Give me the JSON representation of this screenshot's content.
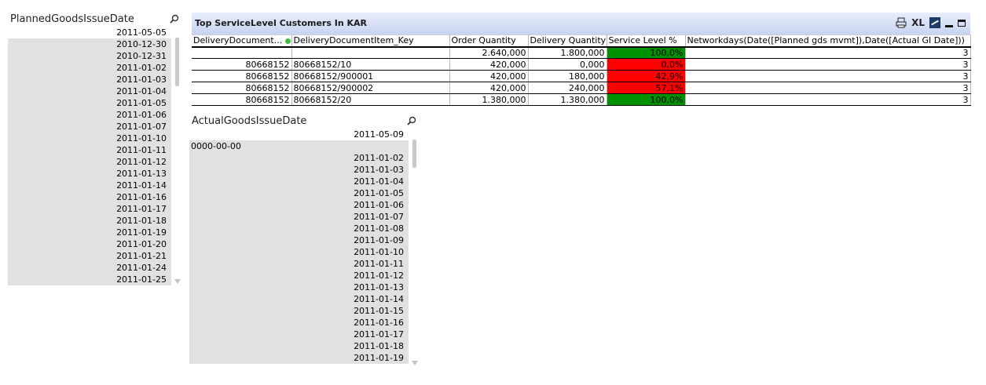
{
  "planned_listbox": {
    "title": "PlannedGoodsIssueDate",
    "items": [
      {
        "label": "2011-05-05",
        "state": "selected"
      },
      {
        "label": "2010-12-30",
        "state": "excluded"
      },
      {
        "label": "2010-12-31",
        "state": "excluded"
      },
      {
        "label": "2011-01-02",
        "state": "excluded"
      },
      {
        "label": "2011-01-03",
        "state": "excluded"
      },
      {
        "label": "2011-01-04",
        "state": "excluded"
      },
      {
        "label": "2011-01-05",
        "state": "excluded"
      },
      {
        "label": "2011-01-06",
        "state": "excluded"
      },
      {
        "label": "2011-01-07",
        "state": "excluded"
      },
      {
        "label": "2011-01-10",
        "state": "excluded"
      },
      {
        "label": "2011-01-11",
        "state": "excluded"
      },
      {
        "label": "2011-01-12",
        "state": "excluded"
      },
      {
        "label": "2011-01-13",
        "state": "excluded"
      },
      {
        "label": "2011-01-14",
        "state": "excluded"
      },
      {
        "label": "2011-01-16",
        "state": "excluded"
      },
      {
        "label": "2011-01-17",
        "state": "excluded"
      },
      {
        "label": "2011-01-18",
        "state": "excluded"
      },
      {
        "label": "2011-01-19",
        "state": "excluded"
      },
      {
        "label": "2011-01-20",
        "state": "excluded"
      },
      {
        "label": "2011-01-21",
        "state": "excluded"
      },
      {
        "label": "2011-01-24",
        "state": "excluded"
      },
      {
        "label": "2011-01-25",
        "state": "excluded"
      }
    ]
  },
  "actual_listbox": {
    "title": "ActualGoodsIssueDate",
    "items": [
      {
        "label": "2011-05-09",
        "state": "selected"
      },
      {
        "label": "0000-00-00",
        "state": "excluded",
        "align": "left"
      },
      {
        "label": "2011-01-02",
        "state": "excluded"
      },
      {
        "label": "2011-01-03",
        "state": "excluded"
      },
      {
        "label": "2011-01-04",
        "state": "excluded"
      },
      {
        "label": "2011-01-05",
        "state": "excluded"
      },
      {
        "label": "2011-01-06",
        "state": "excluded"
      },
      {
        "label": "2011-01-07",
        "state": "excluded"
      },
      {
        "label": "2011-01-08",
        "state": "excluded"
      },
      {
        "label": "2011-01-09",
        "state": "excluded"
      },
      {
        "label": "2011-01-10",
        "state": "excluded"
      },
      {
        "label": "2011-01-11",
        "state": "excluded"
      },
      {
        "label": "2011-01-12",
        "state": "excluded"
      },
      {
        "label": "2011-01-13",
        "state": "excluded"
      },
      {
        "label": "2011-01-14",
        "state": "excluded"
      },
      {
        "label": "2011-01-15",
        "state": "excluded"
      },
      {
        "label": "2011-01-16",
        "state": "excluded"
      },
      {
        "label": "2011-01-17",
        "state": "excluded"
      },
      {
        "label": "2011-01-18",
        "state": "excluded"
      },
      {
        "label": "2011-01-19",
        "state": "excluded"
      }
    ]
  },
  "table": {
    "title": "Top ServiceLevel Customers In KAR",
    "icons": {
      "print": "print-icon",
      "excel": "XL",
      "chart": "chart-icon",
      "minimize": "minimize-icon",
      "maximize": "maximize-icon"
    },
    "columns": [
      "DeliveryDocument...",
      "DeliveryDocumentItem_Key",
      "Order Quantity",
      "Delivery Quantity",
      "Service Level %",
      "Networkdays(Date([Planned gds mvmt]),Date([Actual GI Date]))"
    ],
    "rows": [
      {
        "doc": "",
        "item": "",
        "order": "2.640,000",
        "delivery": "1.800,000",
        "service": "100,0%",
        "service_status": "good",
        "networkdays": "3"
      },
      {
        "doc": "80668152",
        "item": "80668152/10",
        "order": "420,000",
        "delivery": "0,000",
        "service": "0,0%",
        "service_status": "bad",
        "networkdays": "3"
      },
      {
        "doc": "80668152",
        "item": "80668152/900001",
        "order": "420,000",
        "delivery": "180,000",
        "service": "42,9%",
        "service_status": "bad",
        "networkdays": "3"
      },
      {
        "doc": "80668152",
        "item": "80668152/900002",
        "order": "420,000",
        "delivery": "240,000",
        "service": "57,1%",
        "service_status": "bad",
        "networkdays": "3"
      },
      {
        "doc": "80668152",
        "item": "80668152/20",
        "order": "1.380,000",
        "delivery": "1.380,000",
        "service": "100,0%",
        "service_status": "good",
        "networkdays": "3"
      }
    ]
  },
  "colors": {
    "good": "#009000",
    "bad": "#ff0000",
    "excluded": "#e2e0e2",
    "caption": "#c7d3f0"
  }
}
